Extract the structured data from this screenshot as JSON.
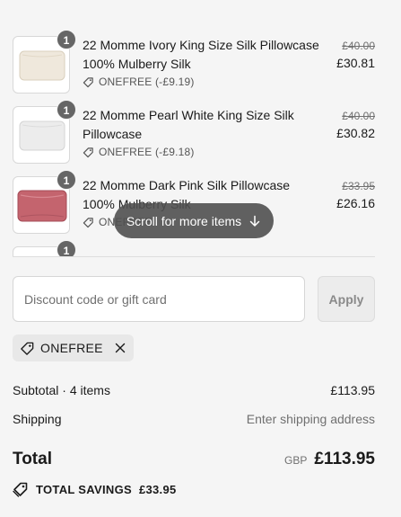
{
  "items": [
    {
      "quantity": "1",
      "title": "22 Momme Ivory King Size Silk Pillowcase 100% Mulberry Silk",
      "discount": "ONEFREE (-£9.19)",
      "original_price": "£40.00",
      "price": "£30.81",
      "color": "#efe8dc"
    },
    {
      "quantity": "1",
      "title": "22 Momme Pearl White King Size Silk Pillowcase",
      "discount": "ONEFREE (-£9.18)",
      "original_price": "£40.00",
      "price": "£30.82",
      "color": "#ebebeb"
    },
    {
      "quantity": "1",
      "title": "22 Momme Dark Pink Silk Pillowcase 100% Mulberry Silk",
      "discount": "ONEFREE",
      "original_price": "£33.95",
      "price": "£26.16",
      "color": "#c4646e"
    },
    {
      "quantity": "1"
    }
  ],
  "scroll_hint": "Scroll for more items",
  "discount_field": {
    "placeholder": "Discount code or gift card",
    "value": "",
    "apply_label": "Apply"
  },
  "applied_code": "ONEFREE",
  "summary": {
    "subtotal_label": "Subtotal · 4 items",
    "subtotal_value": "£113.95",
    "shipping_label": "Shipping",
    "shipping_value": "Enter shipping address",
    "total_label": "Total",
    "currency": "GBP",
    "total_value": "£113.95",
    "savings_label": "TOTAL SAVINGS",
    "savings_value": "£33.95"
  },
  "colors": {
    "background": "#f5f5f5",
    "badge": "#666666",
    "muted_text": "#707070"
  }
}
